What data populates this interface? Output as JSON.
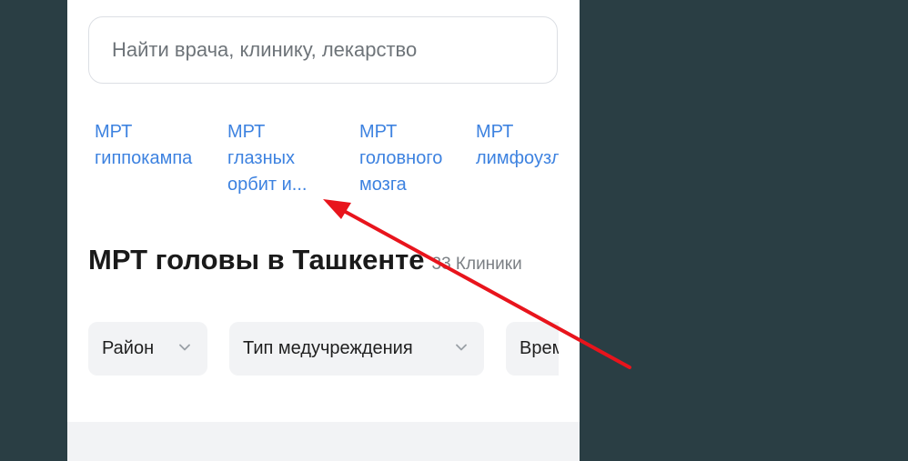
{
  "search": {
    "placeholder": "Найти врача, клинику, лекарство"
  },
  "chips": [
    {
      "line1": "МРТ",
      "line2": "гиппокампа",
      "line3": ""
    },
    {
      "line1": "МРТ",
      "line2": "глазных",
      "line3": "орбит и..."
    },
    {
      "line1": "МРТ",
      "line2": "головного",
      "line3": "мозга"
    },
    {
      "line1": "МРТ",
      "line2": "лимфоузл",
      "line3": ""
    }
  ],
  "heading": {
    "title": "МРТ головы в Ташкенте",
    "count": "33 Клиники"
  },
  "filters": [
    {
      "label": "Район"
    },
    {
      "label": "Тип медучреждения"
    },
    {
      "label": "Врем"
    }
  ],
  "colors": {
    "background": "#2a3e44",
    "link": "#3d82e0",
    "annotation_arrow": "#e8141c"
  }
}
